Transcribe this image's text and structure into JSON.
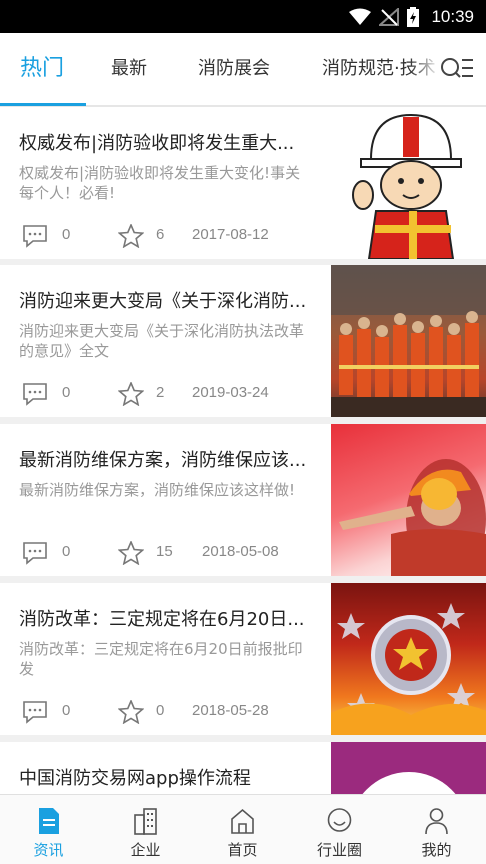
{
  "status_bar": {
    "time": "10:39"
  },
  "tabs": [
    {
      "label": "热门",
      "active": true
    },
    {
      "label": "最新",
      "active": false
    },
    {
      "label": "消防展会",
      "active": false
    },
    {
      "label": "消防规范·技术",
      "active": false
    }
  ],
  "articles": [
    {
      "title": "权威发布|消防验收即将发生重大...",
      "summary": "权威发布|消防验收即将发生重大变化!事关每个人！必看!",
      "comments": "0",
      "likes": "6",
      "date": "2017-08-12",
      "image": "firefighter-cartoon"
    },
    {
      "title": "消防迎来更大变局《关于深化消防...",
      "summary": "消防迎来更大变局《关于深化消防执法改革的意见》全文",
      "comments": "0",
      "likes": "2",
      "date": "2019-03-24",
      "image": "firefighter-team-photo"
    },
    {
      "title": "最新消防维保方案，消防维保应该...",
      "summary": "最新消防维保方案，消防维保应该这样做!",
      "comments": "0",
      "likes": "15",
      "date": "2018-05-08",
      "image": "worker-helmet-pointing"
    },
    {
      "title": "消防改革：三定规定将在6月20日...",
      "summary": "消防改革：三定规定将在6月20日前报批印发",
      "comments": "0",
      "likes": "0",
      "date": "2018-05-28",
      "image": "fire-emblem-flames"
    },
    {
      "title": "中国消防交易网app操作流程",
      "summary": "",
      "comments": "",
      "likes": "",
      "date": "",
      "image": "purple-circle"
    }
  ],
  "bottom_nav": [
    {
      "label": "资讯",
      "icon": "news-icon",
      "active": true
    },
    {
      "label": "企业",
      "icon": "building-icon",
      "active": false
    },
    {
      "label": "首页",
      "icon": "home-icon",
      "active": false
    },
    {
      "label": "行业圈",
      "icon": "circle-chat-icon",
      "active": false
    },
    {
      "label": "我的",
      "icon": "person-icon",
      "active": false
    }
  ],
  "colors": {
    "accent": "#1aa0e0",
    "status_bar": "#000000",
    "divider": "#f0f0f0"
  }
}
